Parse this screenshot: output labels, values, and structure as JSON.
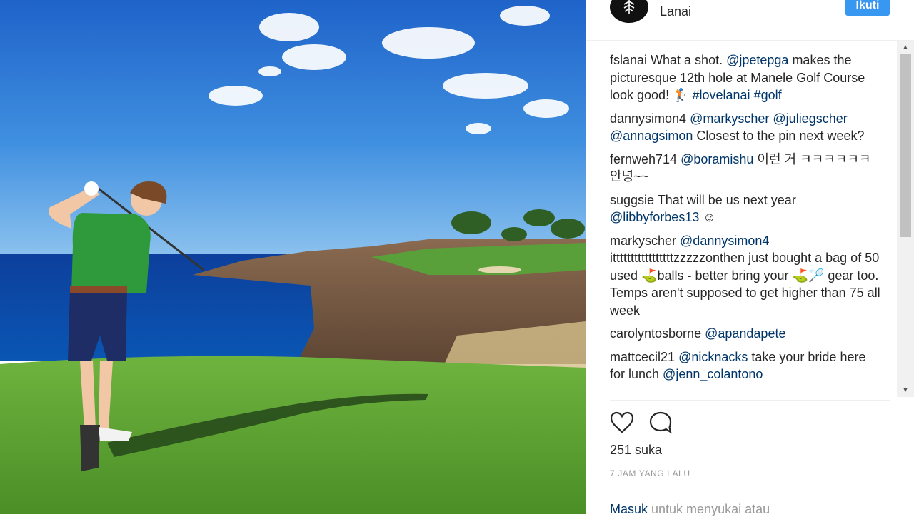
{
  "header": {
    "location": "Lanai",
    "follow_label": "Ikuti"
  },
  "comments": [
    {
      "user": "fslanai",
      "parts": [
        {
          "t": " What a shot. "
        },
        {
          "t": "@jpetepga",
          "m": true
        },
        {
          "t": " makes the picturesque 12th hole at Manele Golf Course look good! 🏌 "
        },
        {
          "t": "#lovelanai",
          "m": true
        },
        {
          "t": " "
        },
        {
          "t": "#golf",
          "m": true
        }
      ]
    },
    {
      "user": "dannysimon4",
      "parts": [
        {
          "t": " "
        },
        {
          "t": "@markyscher",
          "m": true
        },
        {
          "t": " "
        },
        {
          "t": "@juliegscher",
          "m": true
        },
        {
          "t": " "
        },
        {
          "t": "@annagsimon",
          "m": true
        },
        {
          "t": " Closest to the pin next week?"
        }
      ]
    },
    {
      "user": "fernweh714",
      "parts": [
        {
          "t": " "
        },
        {
          "t": "@boramishu",
          "m": true
        },
        {
          "t": " 이런 거 ㅋㅋㅋㅋㅋㅋ 안녕~~"
        }
      ]
    },
    {
      "user": "suggsie",
      "parts": [
        {
          "t": " That will be us next year "
        },
        {
          "t": "@libbyforbes13",
          "m": true
        },
        {
          "t": " ☺"
        }
      ]
    },
    {
      "user": "markyscher",
      "parts": [
        {
          "t": " "
        },
        {
          "t": "@dannysimon4",
          "m": true
        },
        {
          "t": " itttttttttttttttttzzzzzonthen just bought a bag of 50 used ⛳balls - better bring your ⛳🏸 gear too. Temps aren't supposed to get higher than 75 all week"
        }
      ]
    },
    {
      "user": "carolyntosborne",
      "parts": [
        {
          "t": " "
        },
        {
          "t": "@apandapete",
          "m": true
        }
      ]
    },
    {
      "user": "mattcecil21",
      "parts": [
        {
          "t": " "
        },
        {
          "t": "@nicknacks",
          "m": true
        },
        {
          "t": " take your bride here for lunch "
        },
        {
          "t": "@jenn_colantono",
          "m": true
        }
      ]
    }
  ],
  "actions": {
    "like_icon": "heart-icon",
    "comment_icon": "comment-icon"
  },
  "likes_text": "251 suka",
  "time_text": "7 JAM YANG LALU",
  "login": {
    "link": "Masuk",
    "rest": " untuk menyukai atau"
  },
  "colors": {
    "mention": "#003569",
    "button": "#3897f0",
    "text": "#262626",
    "muted": "#999999"
  }
}
